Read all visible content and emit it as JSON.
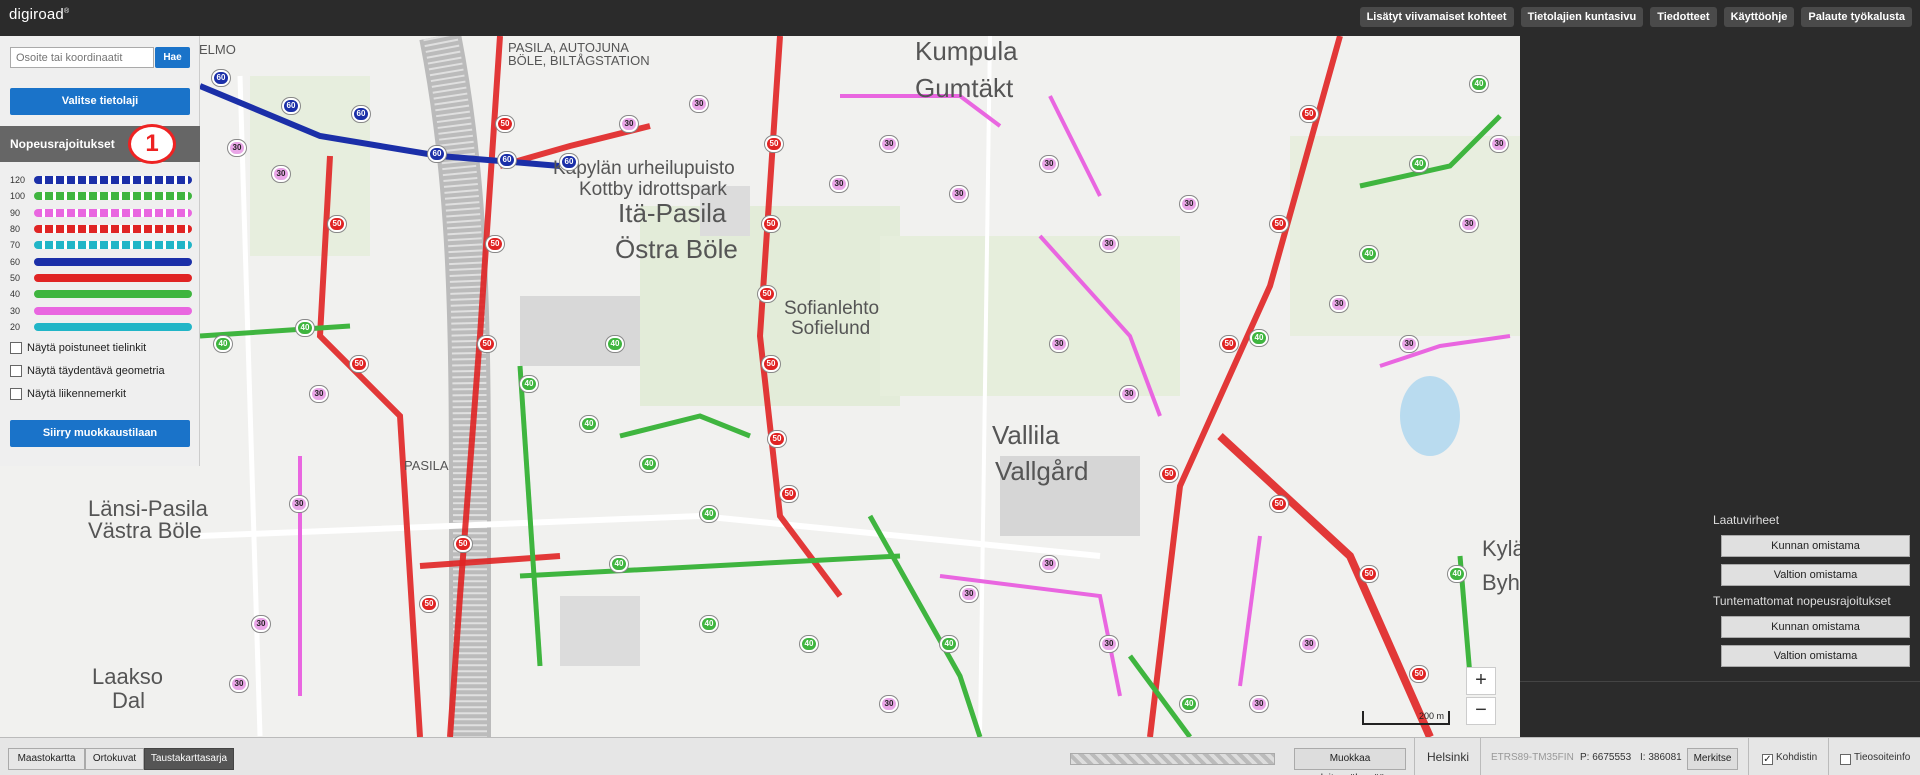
{
  "topbar": {
    "logo": "digiroad",
    "logo_mark": "®",
    "links": [
      "Lisätyt viivamaiset kohteet",
      "Tietolajien kuntasivu",
      "Tiedotteet",
      "Käyttöohje",
      "Palaute työkalusta"
    ]
  },
  "leftpanel": {
    "search_placeholder": "Osoite tai koordinaatit",
    "search_button": "Hae",
    "select_layer_button": "Valitse tietolaji",
    "layer_title": "Nopeusrajoitukset",
    "annotation_number": "1",
    "legend": [
      {
        "label": "120",
        "color": "#1b2fa8",
        "dashed": true
      },
      {
        "label": "100",
        "color": "#3fb53f",
        "dashed": true
      },
      {
        "label": "90",
        "color": "#e966e0",
        "dashed": true
      },
      {
        "label": "80",
        "color": "#e02424",
        "dashed": true
      },
      {
        "label": "70",
        "color": "#21b5c7",
        "dashed": true
      },
      {
        "label": "60",
        "color": "#1b2fa8",
        "dashed": false
      },
      {
        "label": "50",
        "color": "#e02424",
        "dashed": false
      },
      {
        "label": "40",
        "color": "#3fb53f",
        "dashed": false
      },
      {
        "label": "30",
        "color": "#e966e0",
        "dashed": false
      },
      {
        "label": "20",
        "color": "#21b5c7",
        "dashed": false
      }
    ],
    "checkboxes": [
      "Näytä poistuneet tielinkit",
      "Näytä täydentävä geometria",
      "Näytä liikennemerkit"
    ],
    "edit_mode_button": "Siirry muokkaustilaan"
  },
  "map": {
    "places": [
      {
        "name": "PASILA, AUTOJUNA"
      },
      {
        "name": "BÖLE, BILTÅGSTATION"
      },
      {
        "name": "Kumpula"
      },
      {
        "name": "Gumtäkt"
      },
      {
        "name": "Käpylän urheilupuisto"
      },
      {
        "name": "Kottby idrottspark"
      },
      {
        "name": "Itä-Pasila"
      },
      {
        "name": "Östra Böle"
      },
      {
        "name": "Sofianlehto"
      },
      {
        "name": "Sofielund"
      },
      {
        "name": "Vallila"
      },
      {
        "name": "Vallgård"
      },
      {
        "name": "Länsi-Pasila"
      },
      {
        "name": "Västra Böle"
      },
      {
        "name": "PASILA"
      },
      {
        "name": "Laakso"
      },
      {
        "name": "Dal"
      },
      {
        "name": "Kylä"
      },
      {
        "name": "Byhe"
      },
      {
        "name": "ELMO"
      }
    ],
    "badges": [
      "30",
      "40",
      "50",
      "60"
    ],
    "scale_label": "200 m",
    "zoom_in": "+",
    "zoom_out": "−"
  },
  "rightpanel": {
    "quality_title": "Laatuvirheet",
    "quality_buttons": [
      "Kunnan omistama",
      "Valtion omistama"
    ],
    "unknown_title": "Tuntemattomat nopeusrajoitukset",
    "unknown_buttons": [
      "Kunnan omistama",
      "Valtion omistama"
    ]
  },
  "bottombar": {
    "backgrounds": [
      "Maastokartta",
      "Ortokuvat",
      "Taustakarttasarja"
    ],
    "active_background": "Taustakarttasarja",
    "edit_start_button": "Muokkaa aloitusnäkymää",
    "municipality": "Helsinki",
    "projection": "ETRS89-TM35FIN",
    "p_coord": "P: 6675553",
    "i_coord": "I: 386081",
    "mark_button": "Merkitse",
    "cursor_label": "Kohdistin",
    "cursor_checked": true,
    "roadinfo_label": "Tieosoiteinfo",
    "roadinfo_checked": false
  }
}
